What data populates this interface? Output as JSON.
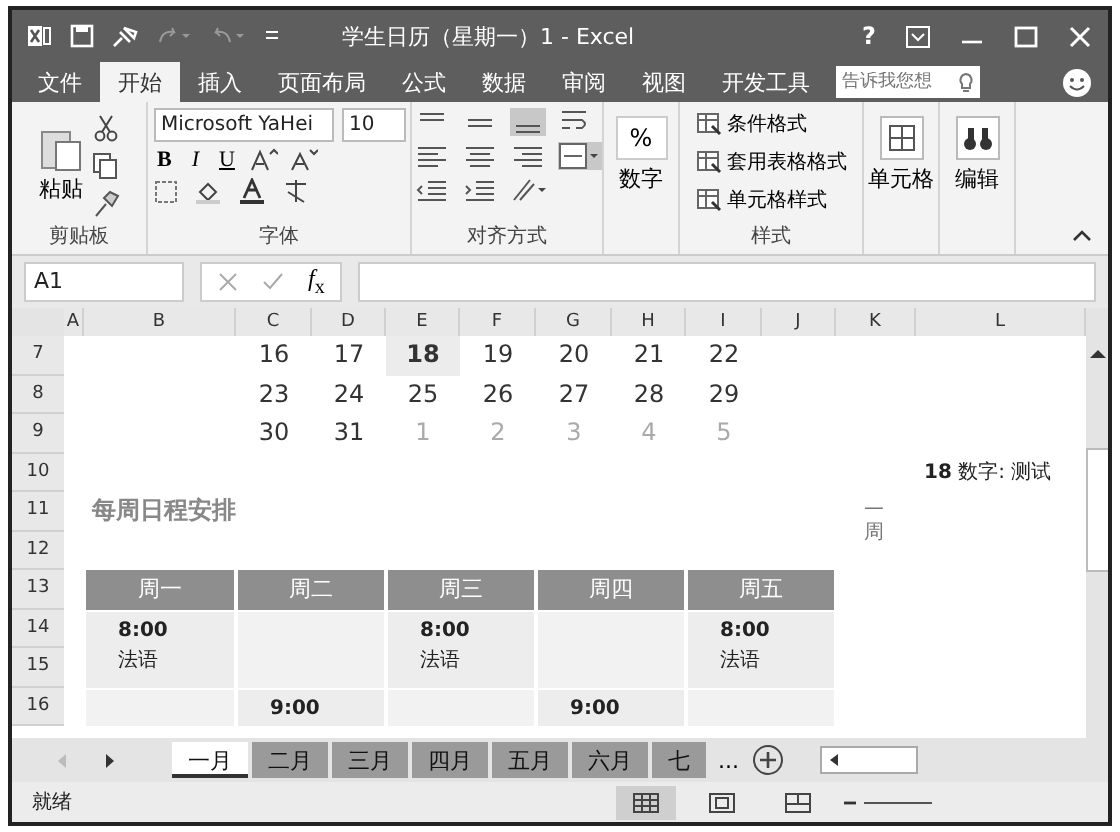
{
  "title_bar": {
    "title": "学生日历（星期一）1 - Excel",
    "help": "?"
  },
  "ribbon_tabs": [
    {
      "label": "文件",
      "selected": false
    },
    {
      "label": "开始",
      "selected": true
    },
    {
      "label": "插入",
      "selected": false
    },
    {
      "label": "页面布局",
      "selected": false
    },
    {
      "label": "公式",
      "selected": false
    },
    {
      "label": "数据",
      "selected": false
    },
    {
      "label": "审阅",
      "selected": false
    },
    {
      "label": "视图",
      "selected": false
    },
    {
      "label": "开发工具",
      "selected": false
    }
  ],
  "tell_me": {
    "placeholder": "告诉我您想"
  },
  "ribbon": {
    "clipboard": {
      "paste": "粘贴",
      "label": "剪贴板"
    },
    "font": {
      "name": "Microsoft YaHei",
      "size": "10",
      "bold": "B",
      "italic": "I",
      "underline": "U",
      "label": "字体"
    },
    "alignment": {
      "label": "对齐方式"
    },
    "number": {
      "symbol": "%",
      "button": "数字"
    },
    "styles": {
      "items": [
        "条件格式",
        "套用表格格式",
        "单元格样式"
      ],
      "label": "样式"
    },
    "cells": {
      "button": "单元格"
    },
    "editing": {
      "button": "编辑"
    }
  },
  "formula_bar": {
    "name_box": "A1",
    "fx": "*f*$_{x}$"
  },
  "sheet": {
    "columns": [
      "A",
      "B",
      "C",
      "D",
      "E",
      "F",
      "G",
      "H",
      "I",
      "J",
      "K",
      "L"
    ],
    "rows": [
      "7",
      "8",
      "9",
      "10",
      "11",
      "12",
      "13",
      "14",
      "15",
      "16"
    ],
    "weeks": [
      {
        "days": [
          {
            "text": "16",
            "muted": false,
            "today": false
          },
          {
            "text": "17",
            "muted": false,
            "today": false
          },
          {
            "text": "18",
            "muted": false,
            "today": true
          },
          {
            "text": "19",
            "muted": false,
            "today": false
          },
          {
            "text": "20",
            "muted": false,
            "today": false
          },
          {
            "text": "21",
            "muted": false,
            "today": false
          },
          {
            "text": "22",
            "muted": false,
            "today": false
          }
        ]
      },
      {
        "days": [
          {
            "text": "23",
            "muted": false,
            "today": false
          },
          {
            "text": "24",
            "muted": false,
            "today": false
          },
          {
            "text": "25",
            "muted": false,
            "today": false
          },
          {
            "text": "26",
            "muted": false,
            "today": false
          },
          {
            "text": "27",
            "muted": false,
            "today": false
          },
          {
            "text": "28",
            "muted": false,
            "today": false
          },
          {
            "text": "29",
            "muted": false,
            "today": false
          }
        ]
      },
      {
        "days": [
          {
            "text": "30",
            "muted": false,
            "today": false
          },
          {
            "text": "31",
            "muted": false,
            "today": false
          },
          {
            "text": "1",
            "muted": true,
            "today": false
          },
          {
            "text": "2",
            "muted": true,
            "today": false
          },
          {
            "text": "3",
            "muted": true,
            "today": false
          },
          {
            "text": "4",
            "muted": true,
            "today": false
          },
          {
            "text": "5",
            "muted": true,
            "today": false
          }
        ]
      }
    ],
    "note": "**18** 数字: 测试",
    "side_label": "一周",
    "schedule": {
      "title": "每周日程安排",
      "days": [
        "周一",
        "周二",
        "周三",
        "周四",
        "周五"
      ],
      "rows": [
        {
          "cells": [
            {
              "time": "8:00",
              "subject": "法语"
            },
            null,
            {
              "time": "8:00",
              "subject": "法语"
            },
            null,
            {
              "time": "8:00",
              "subject": "法语"
            }
          ]
        },
        {
          "cells": [
            null,
            {
              "time": "9:00"
            },
            null,
            {
              "time": "9:00"
            },
            null
          ]
        }
      ]
    }
  },
  "sheet_tabs": [
    {
      "label": "一月",
      "selected": true
    },
    {
      "label": "二月",
      "selected": false
    },
    {
      "label": "三月",
      "selected": false
    },
    {
      "label": "四月",
      "selected": false
    },
    {
      "label": "五月",
      "selected": false
    },
    {
      "label": "六月",
      "selected": false
    },
    {
      "label": "七",
      "selected": false
    }
  ],
  "more_tabs": "...",
  "status": {
    "text": "就绪",
    "views": [
      {
        "kind": "normal",
        "selected": true
      },
      {
        "kind": "layout",
        "selected": false
      },
      {
        "kind": "break",
        "selected": false
      }
    ]
  }
}
